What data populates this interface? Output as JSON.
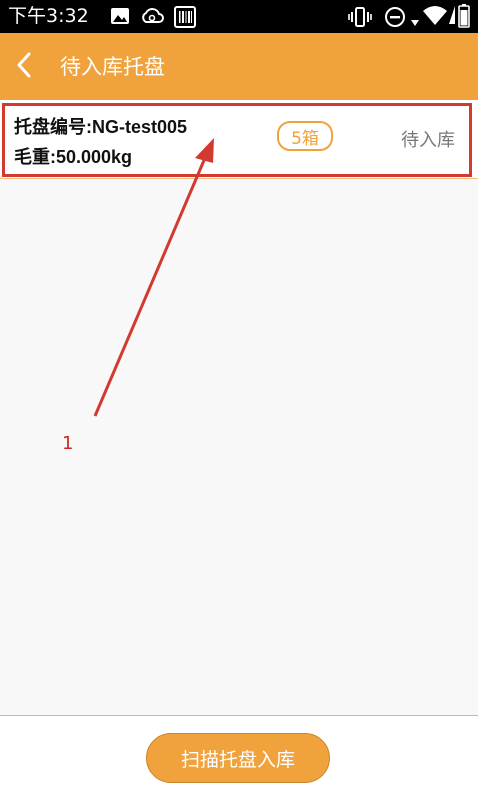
{
  "status_bar": {
    "time": "下午3:32",
    "left_icons": [
      "image-icon",
      "cloud-sync-icon",
      "barcode-icon"
    ],
    "right_icons": [
      "vibrate-icon",
      "do-not-disturb-icon",
      "wifi-icon",
      "signal-icon",
      "battery-icon"
    ]
  },
  "app_bar": {
    "title": "待入库托盘",
    "back_icon": "chevron-left-icon"
  },
  "pallet_list": [
    {
      "pallet_no_text": "托盘编号:NG-test005",
      "gross_weight_text": "毛重:50.000kg",
      "box_count": "5箱",
      "status": "待入库"
    }
  ],
  "annotation": {
    "label": "1",
    "color": "#d23a30"
  },
  "footer": {
    "scan_button_label": "扫描托盘入库"
  },
  "colors": {
    "accent": "#f0a23c",
    "annotation_red": "#d23a30",
    "status_gray": "#777777"
  }
}
